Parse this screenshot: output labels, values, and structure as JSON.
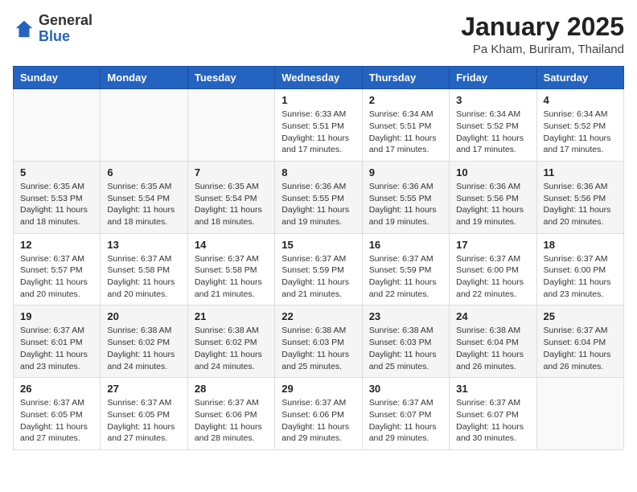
{
  "header": {
    "logo_general": "General",
    "logo_blue": "Blue",
    "title": "January 2025",
    "subtitle": "Pa Kham, Buriram, Thailand"
  },
  "weekdays": [
    "Sunday",
    "Monday",
    "Tuesday",
    "Wednesday",
    "Thursday",
    "Friday",
    "Saturday"
  ],
  "weeks": [
    [
      {
        "day": "",
        "info": ""
      },
      {
        "day": "",
        "info": ""
      },
      {
        "day": "",
        "info": ""
      },
      {
        "day": "1",
        "info": "Sunrise: 6:33 AM\nSunset: 5:51 PM\nDaylight: 11 hours\nand 17 minutes."
      },
      {
        "day": "2",
        "info": "Sunrise: 6:34 AM\nSunset: 5:51 PM\nDaylight: 11 hours\nand 17 minutes."
      },
      {
        "day": "3",
        "info": "Sunrise: 6:34 AM\nSunset: 5:52 PM\nDaylight: 11 hours\nand 17 minutes."
      },
      {
        "day": "4",
        "info": "Sunrise: 6:34 AM\nSunset: 5:52 PM\nDaylight: 11 hours\nand 17 minutes."
      }
    ],
    [
      {
        "day": "5",
        "info": "Sunrise: 6:35 AM\nSunset: 5:53 PM\nDaylight: 11 hours\nand 18 minutes."
      },
      {
        "day": "6",
        "info": "Sunrise: 6:35 AM\nSunset: 5:54 PM\nDaylight: 11 hours\nand 18 minutes."
      },
      {
        "day": "7",
        "info": "Sunrise: 6:35 AM\nSunset: 5:54 PM\nDaylight: 11 hours\nand 18 minutes."
      },
      {
        "day": "8",
        "info": "Sunrise: 6:36 AM\nSunset: 5:55 PM\nDaylight: 11 hours\nand 19 minutes."
      },
      {
        "day": "9",
        "info": "Sunrise: 6:36 AM\nSunset: 5:55 PM\nDaylight: 11 hours\nand 19 minutes."
      },
      {
        "day": "10",
        "info": "Sunrise: 6:36 AM\nSunset: 5:56 PM\nDaylight: 11 hours\nand 19 minutes."
      },
      {
        "day": "11",
        "info": "Sunrise: 6:36 AM\nSunset: 5:56 PM\nDaylight: 11 hours\nand 20 minutes."
      }
    ],
    [
      {
        "day": "12",
        "info": "Sunrise: 6:37 AM\nSunset: 5:57 PM\nDaylight: 11 hours\nand 20 minutes."
      },
      {
        "day": "13",
        "info": "Sunrise: 6:37 AM\nSunset: 5:58 PM\nDaylight: 11 hours\nand 20 minutes."
      },
      {
        "day": "14",
        "info": "Sunrise: 6:37 AM\nSunset: 5:58 PM\nDaylight: 11 hours\nand 21 minutes."
      },
      {
        "day": "15",
        "info": "Sunrise: 6:37 AM\nSunset: 5:59 PM\nDaylight: 11 hours\nand 21 minutes."
      },
      {
        "day": "16",
        "info": "Sunrise: 6:37 AM\nSunset: 5:59 PM\nDaylight: 11 hours\nand 22 minutes."
      },
      {
        "day": "17",
        "info": "Sunrise: 6:37 AM\nSunset: 6:00 PM\nDaylight: 11 hours\nand 22 minutes."
      },
      {
        "day": "18",
        "info": "Sunrise: 6:37 AM\nSunset: 6:00 PM\nDaylight: 11 hours\nand 23 minutes."
      }
    ],
    [
      {
        "day": "19",
        "info": "Sunrise: 6:37 AM\nSunset: 6:01 PM\nDaylight: 11 hours\nand 23 minutes."
      },
      {
        "day": "20",
        "info": "Sunrise: 6:38 AM\nSunset: 6:02 PM\nDaylight: 11 hours\nand 24 minutes."
      },
      {
        "day": "21",
        "info": "Sunrise: 6:38 AM\nSunset: 6:02 PM\nDaylight: 11 hours\nand 24 minutes."
      },
      {
        "day": "22",
        "info": "Sunrise: 6:38 AM\nSunset: 6:03 PM\nDaylight: 11 hours\nand 25 minutes."
      },
      {
        "day": "23",
        "info": "Sunrise: 6:38 AM\nSunset: 6:03 PM\nDaylight: 11 hours\nand 25 minutes."
      },
      {
        "day": "24",
        "info": "Sunrise: 6:38 AM\nSunset: 6:04 PM\nDaylight: 11 hours\nand 26 minutes."
      },
      {
        "day": "25",
        "info": "Sunrise: 6:37 AM\nSunset: 6:04 PM\nDaylight: 11 hours\nand 26 minutes."
      }
    ],
    [
      {
        "day": "26",
        "info": "Sunrise: 6:37 AM\nSunset: 6:05 PM\nDaylight: 11 hours\nand 27 minutes."
      },
      {
        "day": "27",
        "info": "Sunrise: 6:37 AM\nSunset: 6:05 PM\nDaylight: 11 hours\nand 27 minutes."
      },
      {
        "day": "28",
        "info": "Sunrise: 6:37 AM\nSunset: 6:06 PM\nDaylight: 11 hours\nand 28 minutes."
      },
      {
        "day": "29",
        "info": "Sunrise: 6:37 AM\nSunset: 6:06 PM\nDaylight: 11 hours\nand 29 minutes."
      },
      {
        "day": "30",
        "info": "Sunrise: 6:37 AM\nSunset: 6:07 PM\nDaylight: 11 hours\nand 29 minutes."
      },
      {
        "day": "31",
        "info": "Sunrise: 6:37 AM\nSunset: 6:07 PM\nDaylight: 11 hours\nand 30 minutes."
      },
      {
        "day": "",
        "info": ""
      }
    ]
  ]
}
